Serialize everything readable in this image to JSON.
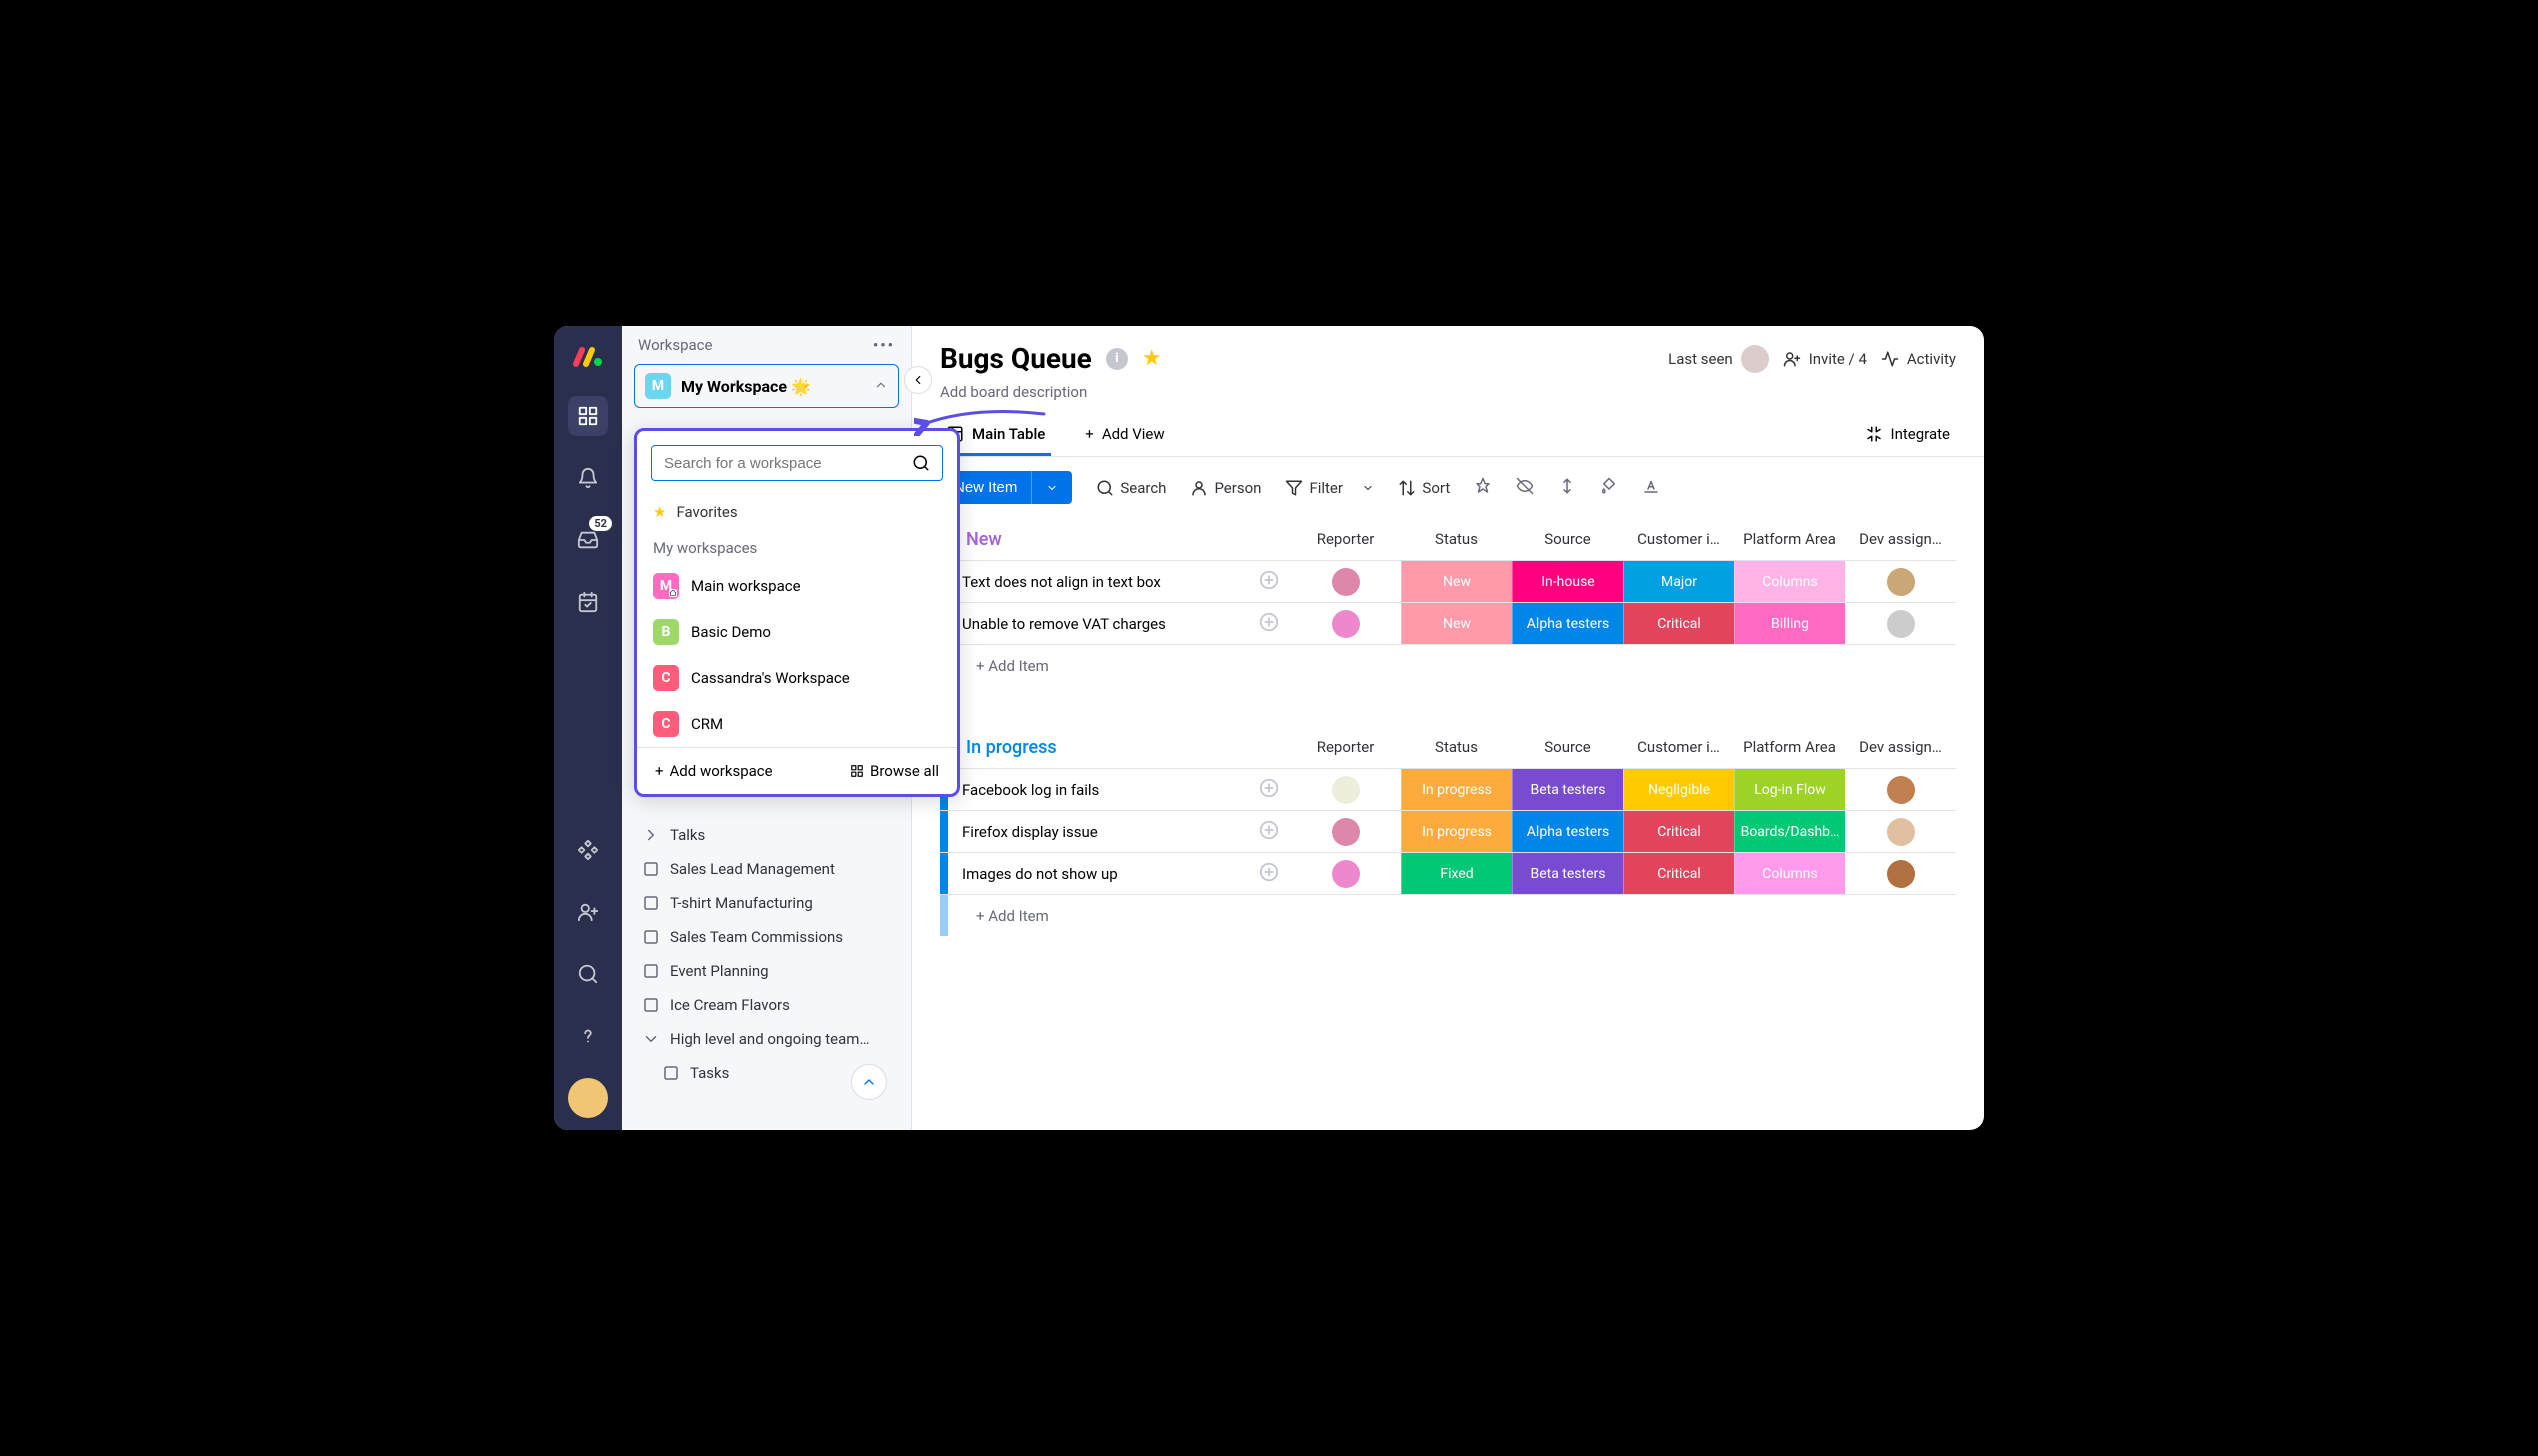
{
  "sidebar_header": "Workspace",
  "selected_workspace": {
    "badge": "M",
    "name": "My Workspace 🌟",
    "color": "#6ad6f0"
  },
  "dropdown": {
    "search_placeholder": "Search for a workspace",
    "favorites_label": "Favorites",
    "section_label": "My workspaces",
    "items": [
      {
        "badge": "M",
        "name": "Main workspace",
        "color": "#ff6ac2",
        "home": true
      },
      {
        "badge": "B",
        "name": "Basic Demo",
        "color": "#9ed86a"
      },
      {
        "badge": "C",
        "name": "Cassandra's Workspace",
        "color": "#ff5b7a"
      },
      {
        "badge": "C",
        "name": "CRM",
        "color": "#ff5b7a"
      }
    ],
    "add_label": "Add workspace",
    "browse_label": "Browse all"
  },
  "inbox_badge": "52",
  "nav": [
    {
      "label": "Talks",
      "type": "caret"
    },
    {
      "label": "Sales Lead Management",
      "type": "board"
    },
    {
      "label": "T-shirt Manufacturing",
      "type": "board"
    },
    {
      "label": "Sales Team Commissions",
      "type": "board"
    },
    {
      "label": "Event Planning",
      "type": "board"
    },
    {
      "label": "Ice Cream Flavors",
      "type": "board"
    },
    {
      "label": "High level and ongoing team…",
      "type": "caret-open"
    },
    {
      "label": "Tasks",
      "type": "board",
      "sub": true
    }
  ],
  "board": {
    "title": "Bugs Queue",
    "desc": "Add board description",
    "last_seen": "Last seen",
    "invite": "Invite / 4",
    "activity": "Activity",
    "main_table": "Main Table",
    "add_view": "Add View",
    "integrate": "Integrate"
  },
  "toolbar": {
    "new_item": "New Item",
    "search": "Search",
    "person": "Person",
    "filter": "Filter",
    "sort": "Sort"
  },
  "columns": [
    "Reporter",
    "Status",
    "Source",
    "Customer i…",
    "Platform Area",
    "Dev assign…"
  ],
  "groups": [
    {
      "name": "New",
      "color": "#a25ddc",
      "rows": [
        {
          "name": "Text does not align in text box",
          "cells": [
            {
              "type": "avatar",
              "bg": "#d8a"
            },
            {
              "text": "New",
              "bg": "#ff9aaa"
            },
            {
              "text": "In-house",
              "bg": "#ff007f"
            },
            {
              "text": "Major",
              "bg": "#00a1e0"
            },
            {
              "text": "Columns",
              "bg": "#ffb3e6"
            },
            {
              "type": "avatar",
              "bg": "#c9a776"
            }
          ]
        },
        {
          "name": "Unable to remove VAT charges",
          "cells": [
            {
              "type": "avatar",
              "bg": "#e8c"
            },
            {
              "text": "New",
              "bg": "#ff9aaa"
            },
            {
              "text": "Alpha testers",
              "bg": "#0086e8"
            },
            {
              "text": "Critical",
              "bg": "#e2445c"
            },
            {
              "text": "Billing",
              "bg": "#ff6ac2"
            },
            {
              "type": "avatar",
              "bg": "#ccc"
            }
          ]
        }
      ]
    },
    {
      "name": "In progress",
      "color": "#0086e8",
      "rows": [
        {
          "name": "Facebook log in fails",
          "cells": [
            {
              "type": "avatar",
              "bg": "#eed"
            },
            {
              "text": "In progress",
              "bg": "#fdab3d"
            },
            {
              "text": "Beta testers",
              "bg": "#784bd1"
            },
            {
              "text": "Negligible",
              "bg": "#ffcb00"
            },
            {
              "text": "Log-in Flow",
              "bg": "#9cd326"
            },
            {
              "type": "avatar",
              "bg": "#c08050"
            }
          ]
        },
        {
          "name": "Firefox display issue",
          "cells": [
            {
              "type": "avatar",
              "bg": "#d8a"
            },
            {
              "text": "In progress",
              "bg": "#fdab3d"
            },
            {
              "text": "Alpha testers",
              "bg": "#0086e8"
            },
            {
              "text": "Critical",
              "bg": "#e2445c"
            },
            {
              "text": "Boards/Dashb…",
              "bg": "#00c875"
            },
            {
              "type": "avatar",
              "bg": "#e0c0a0"
            }
          ]
        },
        {
          "name": "Images do not show up",
          "cells": [
            {
              "type": "avatar",
              "bg": "#e8c"
            },
            {
              "text": "Fixed",
              "bg": "#00c875"
            },
            {
              "text": "Beta testers",
              "bg": "#784bd1"
            },
            {
              "text": "Critical",
              "bg": "#e2445c"
            },
            {
              "text": "Columns",
              "bg": "#ff9aec"
            },
            {
              "type": "avatar",
              "bg": "#b07040"
            }
          ]
        }
      ]
    }
  ],
  "add_item_label": "+ Add Item"
}
